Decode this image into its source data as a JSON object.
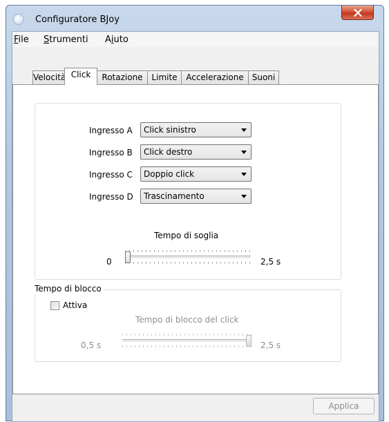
{
  "window": {
    "title": "Configuratore BJoy"
  },
  "menu": {
    "file": {
      "hotkey": "F",
      "rest": "ile"
    },
    "strumenti": {
      "hotkey": "S",
      "rest": "trumenti"
    },
    "aiuto": {
      "pre": "A",
      "hotkey": "i",
      "rest": "uto"
    }
  },
  "tabs": [
    "Velocità",
    "Click",
    "Rotazione",
    "Limite",
    "Accelerazione",
    "Suoni"
  ],
  "active_tab": "Click",
  "inputs": [
    {
      "label": "Ingresso A",
      "value": "Click sinistro"
    },
    {
      "label": "Ingresso B",
      "value": "Click destro"
    },
    {
      "label": "Ingresso C",
      "value": "Doppio click"
    },
    {
      "label": "Ingresso D",
      "value": "Trascinamento"
    }
  ],
  "threshold": {
    "title": "Tempo di soglia",
    "min_label": "0",
    "max_label": "2,5 s",
    "value_fraction": 0.0
  },
  "lock": {
    "group_title": "Tempo di blocco",
    "checkbox_label": "Attiva",
    "checked": false,
    "slider_title": "Tempo di blocco del click",
    "min_label": "0,5 s",
    "max_label": "2,5 s",
    "value_fraction": 1.0
  },
  "buttons": {
    "apply": "Applica",
    "close": "x"
  }
}
